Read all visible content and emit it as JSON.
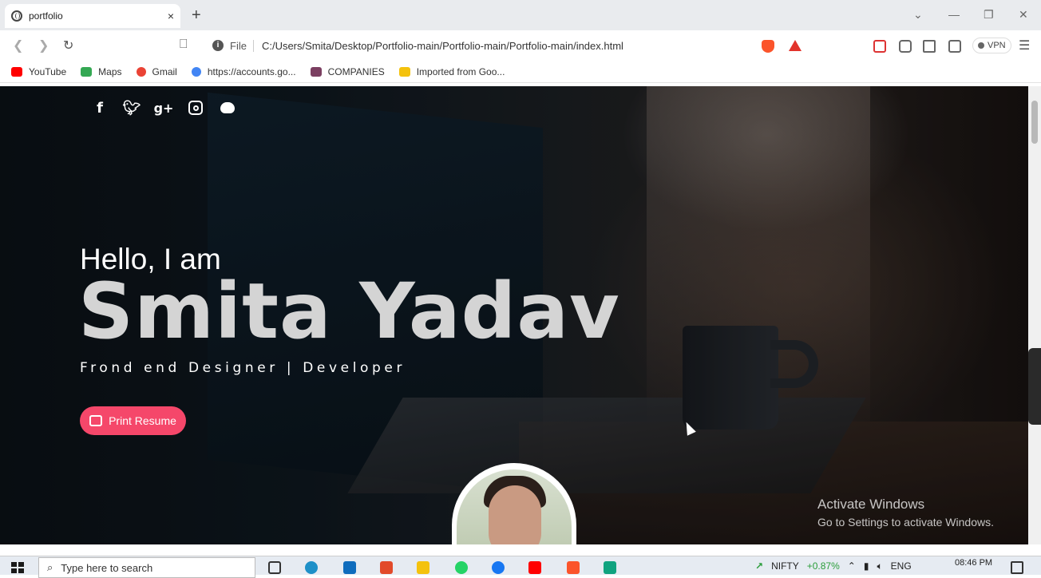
{
  "browser": {
    "tab_title": "portfolio",
    "tab_close": "×",
    "new_tab": "+",
    "address_prefix": "File",
    "url": "C:/Users/Smita/Desktop/Portfolio-main/Portfolio-main/Portfolio-main/index.html",
    "vpn_label": "VPN",
    "notification_count": "1",
    "bookmarks": [
      {
        "label": "YouTube",
        "color": "#ff0000"
      },
      {
        "label": "Maps",
        "color": "#34a853"
      },
      {
        "label": "Gmail",
        "color": "#ea4335"
      },
      {
        "label": "https://accounts.go...",
        "color": "#4285f4"
      },
      {
        "label": "COMPANIES",
        "color": "#7b3f61"
      },
      {
        "label": "Imported from Goo...",
        "color": "#f4c20d"
      }
    ]
  },
  "page": {
    "social_icons": [
      "facebook-icon",
      "twitter-icon",
      "google-plus-icon",
      "instagram-icon",
      "github-icon"
    ],
    "greeting": "Hello, I am",
    "name": "Smita Yadav",
    "role": "Frond end Designer | Developer",
    "resume_button": "Print Resume",
    "accent_color": "#f5476a"
  },
  "watermark": {
    "title": "Activate Windows",
    "subtitle": "Go to Settings to activate Windows."
  },
  "taskbar": {
    "search_placeholder": "Type here to search",
    "ticker": "NIFTY",
    "ticker_change": "+0.87%",
    "language": "ENG",
    "time": "08:46 PM"
  }
}
